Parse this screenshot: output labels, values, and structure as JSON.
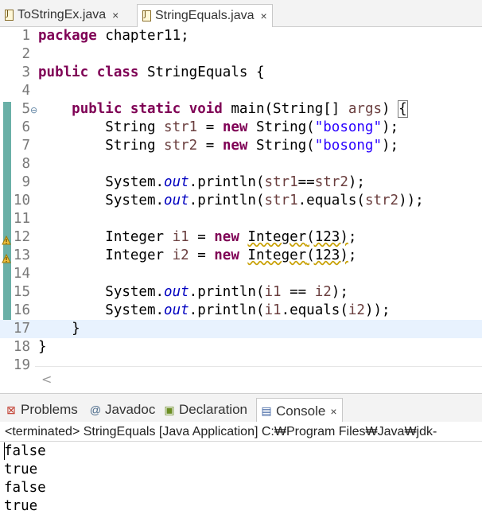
{
  "editor_tabs": [
    {
      "label": "ToStringEx.java",
      "active": false
    },
    {
      "label": "StringEquals.java",
      "active": true
    }
  ],
  "tab_close_glyph": "×",
  "editor": {
    "lines": [
      {
        "n": "1",
        "tokens": [
          [
            "kw",
            "package"
          ],
          [
            "t",
            " chapter11;"
          ]
        ]
      },
      {
        "n": "2",
        "tokens": []
      },
      {
        "n": "3",
        "tokens": [
          [
            "kw",
            "public"
          ],
          [
            "t",
            " "
          ],
          [
            "kw",
            "class"
          ],
          [
            "t",
            " StringEquals {"
          ]
        ]
      },
      {
        "n": "4",
        "tokens": []
      },
      {
        "n": "5",
        "fold": true,
        "tokens": [
          [
            "t",
            "    "
          ],
          [
            "kw",
            "public"
          ],
          [
            "t",
            " "
          ],
          [
            "kw",
            "static"
          ],
          [
            "t",
            " "
          ],
          [
            "kw",
            "void"
          ],
          [
            "t",
            " main(String[] "
          ],
          [
            "var",
            "args"
          ],
          [
            "t",
            ") "
          ],
          [
            "bracket",
            "{"
          ]
        ]
      },
      {
        "n": "6",
        "tokens": [
          [
            "t",
            "        String "
          ],
          [
            "var",
            "str1"
          ],
          [
            "t",
            " = "
          ],
          [
            "kw",
            "new"
          ],
          [
            "t",
            " String("
          ],
          [
            "str",
            "\"bosong\""
          ],
          [
            "t",
            ");"
          ]
        ]
      },
      {
        "n": "7",
        "tokens": [
          [
            "t",
            "        String "
          ],
          [
            "var",
            "str2"
          ],
          [
            "t",
            " = "
          ],
          [
            "kw",
            "new"
          ],
          [
            "t",
            " String("
          ],
          [
            "str",
            "\"bosong\""
          ],
          [
            "t",
            ");"
          ]
        ]
      },
      {
        "n": "8",
        "tokens": []
      },
      {
        "n": "9",
        "tokens": [
          [
            "t",
            "        System."
          ],
          [
            "fld",
            "out"
          ],
          [
            "t",
            ".println("
          ],
          [
            "var",
            "str1"
          ],
          [
            "t",
            "=="
          ],
          [
            "var",
            "str2"
          ],
          [
            "t",
            ");"
          ]
        ]
      },
      {
        "n": "10",
        "tokens": [
          [
            "t",
            "        System."
          ],
          [
            "fld",
            "out"
          ],
          [
            "t",
            ".println("
          ],
          [
            "var",
            "str1"
          ],
          [
            "t",
            ".equals("
          ],
          [
            "var",
            "str2"
          ],
          [
            "t",
            "));"
          ]
        ]
      },
      {
        "n": "11",
        "tokens": []
      },
      {
        "n": "12",
        "warning": true,
        "tokens": [
          [
            "t",
            "        Integer "
          ],
          [
            "var",
            "i1"
          ],
          [
            "t",
            " = "
          ],
          [
            "kw",
            "new"
          ],
          [
            "t",
            " "
          ],
          [
            "dep",
            "Integer"
          ],
          [
            "wavy",
            "(123)"
          ],
          [
            "t",
            ";"
          ]
        ]
      },
      {
        "n": "13",
        "warning": true,
        "tokens": [
          [
            "t",
            "        Integer "
          ],
          [
            "var",
            "i2"
          ],
          [
            "t",
            " = "
          ],
          [
            "kw",
            "new"
          ],
          [
            "t",
            " "
          ],
          [
            "dep",
            "Integer"
          ],
          [
            "wavy",
            "(123)"
          ],
          [
            "t",
            ";"
          ]
        ]
      },
      {
        "n": "14",
        "tokens": []
      },
      {
        "n": "15",
        "tokens": [
          [
            "t",
            "        System."
          ],
          [
            "fld",
            "out"
          ],
          [
            "t",
            ".println("
          ],
          [
            "var",
            "i1"
          ],
          [
            "t",
            " == "
          ],
          [
            "var",
            "i2"
          ],
          [
            "t",
            ");"
          ]
        ]
      },
      {
        "n": "16",
        "tokens": [
          [
            "t",
            "        System."
          ],
          [
            "fld",
            "out"
          ],
          [
            "t",
            ".println("
          ],
          [
            "var",
            "i1"
          ],
          [
            "t",
            ".equals("
          ],
          [
            "var",
            "i2"
          ],
          [
            "t",
            "));"
          ]
        ]
      },
      {
        "n": "17",
        "current": true,
        "tokens": [
          [
            "t",
            "    }"
          ]
        ]
      },
      {
        "n": "18",
        "tokens": [
          [
            "t",
            "}"
          ]
        ]
      },
      {
        "n": "19",
        "tokens": []
      }
    ]
  },
  "scroll_left_glyph": "<",
  "panel_tabs": [
    {
      "label": "Problems",
      "icon": "problems-icon",
      "glyph": "⊠",
      "color": "#c0392b"
    },
    {
      "label": "Javadoc",
      "icon": "javadoc-icon",
      "glyph": "@",
      "color": "#4a6a8a"
    },
    {
      "label": "Declaration",
      "icon": "declaration-icon",
      "glyph": "▣",
      "color": "#6b8e23"
    },
    {
      "label": "Console",
      "icon": "console-icon",
      "glyph": "▤",
      "color": "#3a5fa0",
      "active": true
    }
  ],
  "console": {
    "header": "<terminated> StringEquals [Java Application] C:₩Program Files₩Java₩jdk-",
    "output": [
      "false",
      "true",
      "false",
      "true"
    ]
  }
}
